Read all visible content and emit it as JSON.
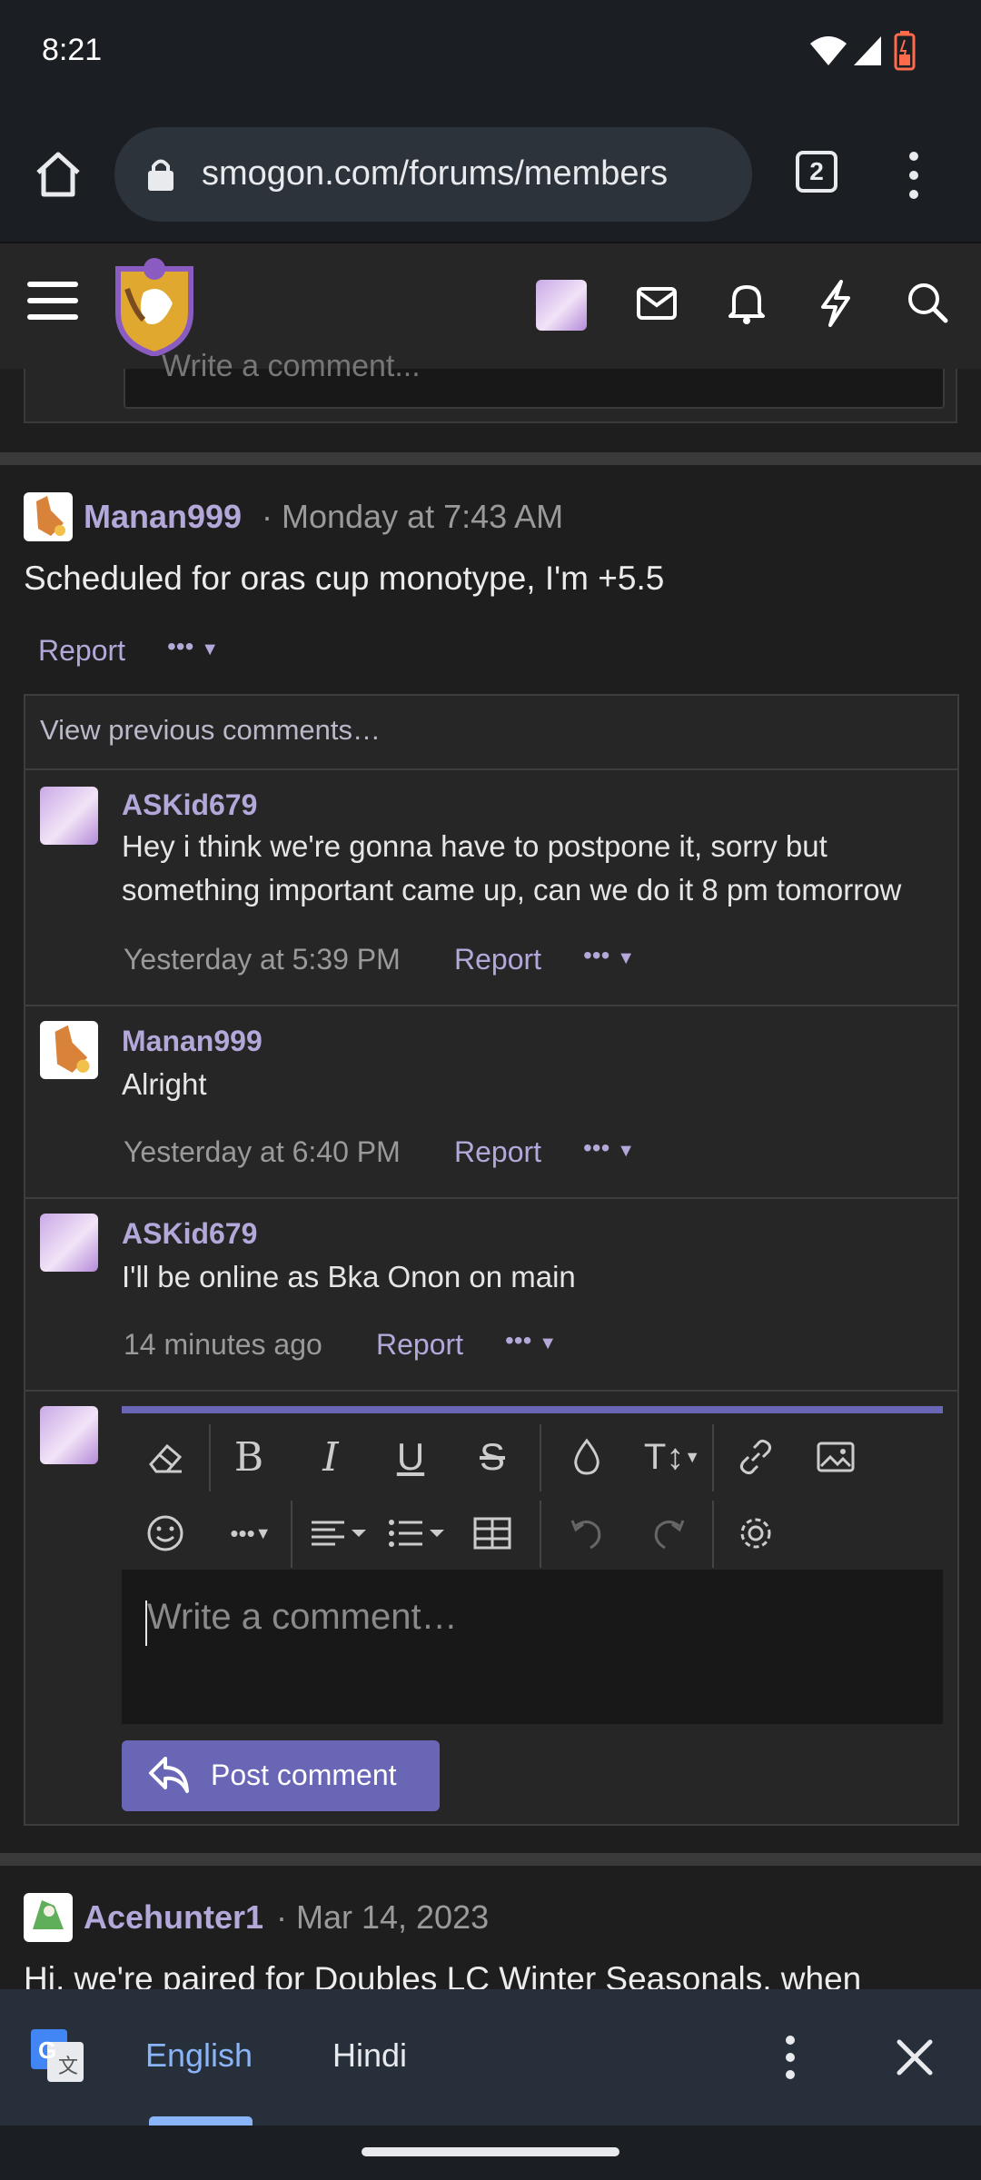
{
  "status": {
    "time": "8:21"
  },
  "browser": {
    "url": "smogon.com/forums/members",
    "tab_count": "2"
  },
  "post1": {
    "author": "Manan999",
    "time": "· Monday at 7:43 AM",
    "text": "Scheduled for oras cup monotype, I'm +5.5",
    "report": "Report",
    "more": "•••"
  },
  "comments": {
    "view_previous": "View previous comments…",
    "items": [
      {
        "author": "ASKid679",
        "text": "Hey i think we're gonna have to postpone it, sorry but something important came up, can we do it 8 pm tomorrow",
        "time": "Yesterday at 5:39 PM",
        "report": "Report",
        "more": "•••"
      },
      {
        "author": "Manan999",
        "text": "Alright",
        "time": "Yesterday at 6:40 PM",
        "report": "Report",
        "more": "•••"
      },
      {
        "author": "ASKid679",
        "text": "I'll be online as Bka Onon on main",
        "time": "14 minutes ago",
        "report": "Report",
        "more": "•••"
      }
    ],
    "editor_placeholder": "Write a comment…",
    "post_button": "Post comment"
  },
  "top_partial": {
    "placeholder": "Write a comment..."
  },
  "post2": {
    "author": "Acehunter1",
    "time": "· Mar 14, 2023",
    "text": "Hi, we're paired for Doubles LC Winter Seasonals, when"
  },
  "translate": {
    "lang1": "English",
    "lang2": "Hindi"
  },
  "colors": {
    "accent": "#6a66b6",
    "username": "#b3a8d9",
    "background": "#1e1e1e"
  }
}
